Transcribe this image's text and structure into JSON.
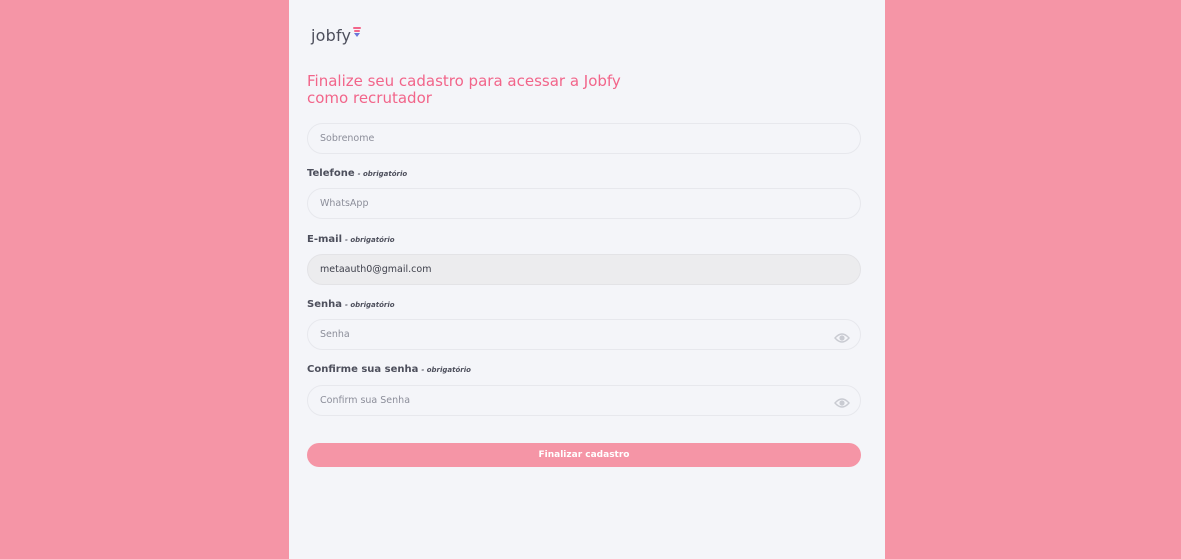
{
  "brand": {
    "name": "jobfy"
  },
  "title": {
    "line1": "Finalize seu cadastro para acessar a Jobfy",
    "line2": "como recrutador"
  },
  "form": {
    "sobrenome": {
      "placeholder": "Sobrenome"
    },
    "telefone": {
      "label": "Telefone",
      "required": "- obrigatório",
      "placeholder": "WhatsApp"
    },
    "email": {
      "label": "E-mail",
      "required": "- obrigatório",
      "value": "metaauth0@gmail.com"
    },
    "senha": {
      "label": "Senha",
      "required": "- obrigatório",
      "placeholder": "Senha"
    },
    "confirme": {
      "label": "Confirme sua senha",
      "required": "- obrigatório",
      "placeholder": "Confirm sua Senha"
    },
    "submit_label": "Finalizar cadastro"
  },
  "colors": {
    "background": "#f595a6",
    "panel": "#f4f5f9",
    "accent": "#f2658a",
    "button": "#f595a6",
    "text": "#4d4f5c"
  },
  "icons": {
    "password_toggle": "eye-icon",
    "logo_mark": "funnel-logo-icon"
  }
}
